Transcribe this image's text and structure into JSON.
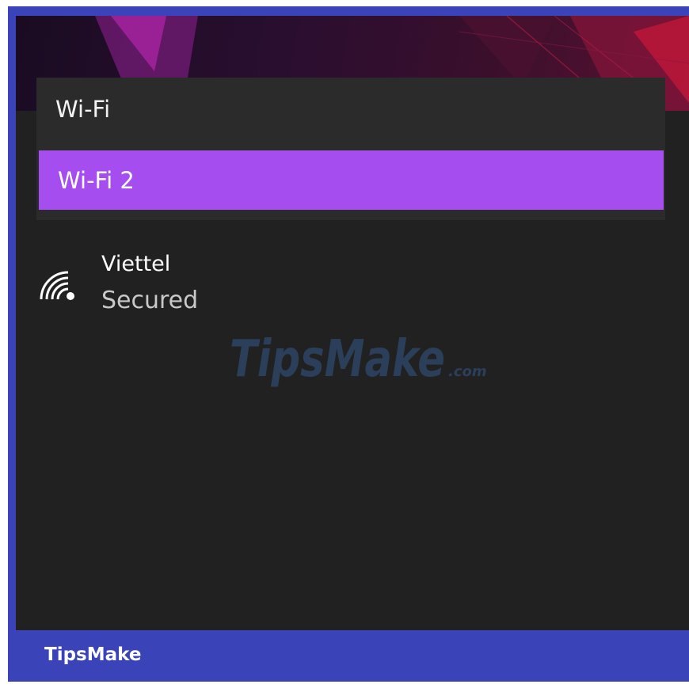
{
  "dropdown": {
    "items": [
      {
        "label": "Wi-Fi",
        "selected": false
      },
      {
        "label": "Wi-Fi 2",
        "selected": true
      }
    ]
  },
  "network": {
    "name": "Viettel",
    "status": "Secured",
    "icon": "wifi-signal-icon"
  },
  "watermark": {
    "text": "TipsMake",
    "suffix": ".com"
  },
  "footer": {
    "brand": "TipsMake"
  },
  "colors": {
    "selected_accent": "#a54dee",
    "panel_background": "#212121",
    "dropdown_background": "#2b2b2b",
    "frame_border": "#3a43b8"
  }
}
